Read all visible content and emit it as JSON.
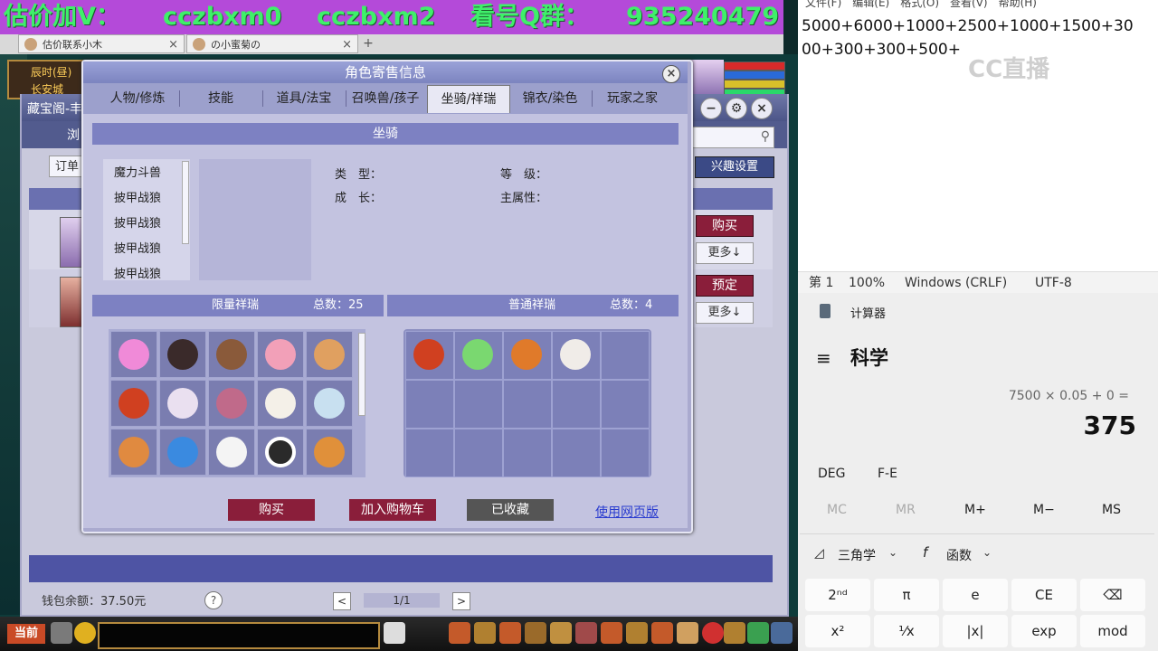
{
  "banner": {
    "part1": "估价加V：",
    "part2": "cczbxm0",
    "part3": "cczbxm2",
    "part4": "看号Q群：",
    "part5": "935240479"
  },
  "browser_tabs": [
    {
      "label": "估价联系小木"
    },
    {
      "label": "の小蜜菊の"
    }
  ],
  "game": {
    "time_label": "辰时(昼)",
    "location": "长安城",
    "hud_current": "当前"
  },
  "cbg": {
    "title": "藏宝阁-丰",
    "nav_first": "浏",
    "order_label": "订单",
    "interest_btn": "兴趣设置",
    "buy_label": "购买",
    "more_label": "更多↓",
    "reserve_label": "预定",
    "more2_label": "更多↓",
    "wallet": "钱包余额：37.50元",
    "help": "?",
    "page": "1/1",
    "prev": "<",
    "next": ">"
  },
  "dialog": {
    "title": "角色寄售信息",
    "close": "×",
    "tabs": [
      "人物/修炼",
      "技能",
      "道具/法宝",
      "召唤兽/孩子",
      "坐骑/祥瑞",
      "锦衣/染色",
      "玩家之家"
    ],
    "active_tab": 4,
    "section_title": "坐骑",
    "mounts": [
      "魔力斗兽",
      "披甲战狼",
      "披甲战狼",
      "披甲战狼",
      "披甲战狼"
    ],
    "attr_type": "类　型：",
    "attr_growth": "成　长：",
    "attr_level": "等　级：",
    "attr_main": "主属性：",
    "limited_title": "限量祥瑞",
    "limited_total": "总数：25",
    "normal_title": "普通祥瑞",
    "normal_total": "总数：4",
    "buttons": {
      "buy": "购买",
      "cart": "加入购物车",
      "fav": "已收藏"
    },
    "web_link": "使用网页版"
  },
  "notepad": {
    "menu": "文件(F)　编辑(E)　格式(O)　查看(V)　帮助(H)",
    "text": "5000+6000+1000+2500+1000+1500+3000+300+300+500+",
    "watermark": "CC直播",
    "status": {
      "line": "第 1",
      "zoom": "100%",
      "eol": "Windows (CRLF)",
      "enc": "UTF-8"
    }
  },
  "calculator": {
    "app_title": "计算器",
    "mode": "科学",
    "expression": "7500 × 0.05 + 0 =",
    "result": "375",
    "deg": "DEG",
    "fe": "F-E",
    "memory": [
      "MC",
      "MR",
      "M+",
      "M−",
      "MS"
    ],
    "trig": "三角学",
    "func": "函数",
    "keys_row1": [
      "2ⁿᵈ",
      "π",
      "e",
      "CE",
      "⌫"
    ],
    "keys_row2": [
      "x²",
      "¹⁄x",
      "|x|",
      "exp",
      "mod"
    ]
  }
}
